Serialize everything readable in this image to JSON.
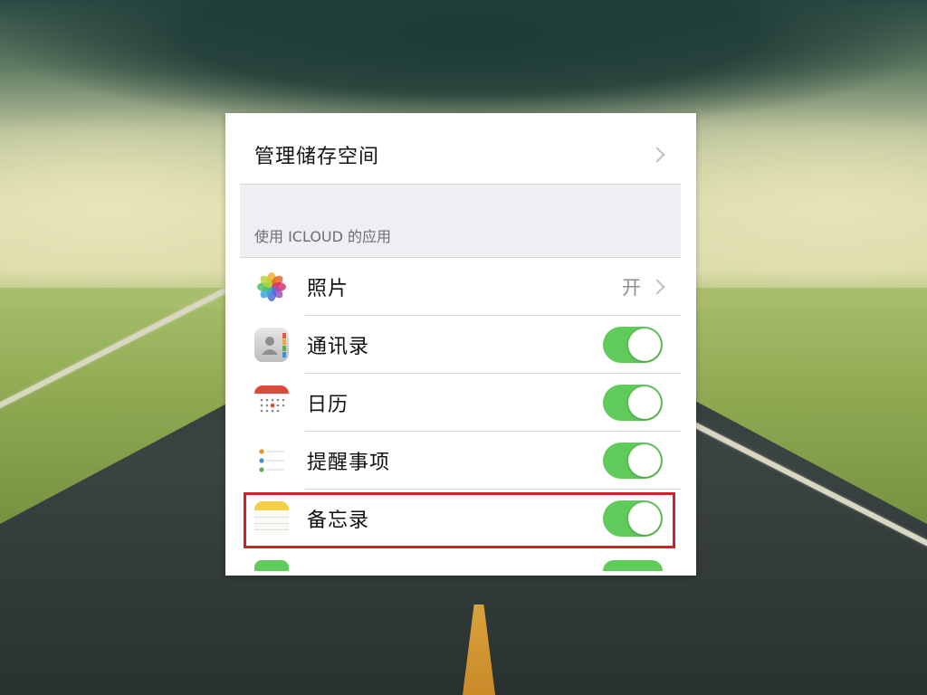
{
  "settings": {
    "manage_storage_label": "管理储存空间",
    "section_title": "使用 ICLOUD 的应用",
    "apps": [
      {
        "label": "照片",
        "icon": "photos-icon",
        "value": "开"
      },
      {
        "label": "通讯录",
        "icon": "contacts-icon",
        "toggle": "on"
      },
      {
        "label": "日历",
        "icon": "calendar-icon",
        "toggle": "on"
      },
      {
        "label": "提醒事项",
        "icon": "reminders-icon",
        "toggle": "on"
      },
      {
        "label": "备忘录",
        "icon": "notes-icon",
        "toggle": "on",
        "highlighted": true
      }
    ]
  },
  "colors": {
    "toggle_on": "#5fcb5b",
    "highlight_border": "#d2202a",
    "section_background": "#eeeef3"
  }
}
